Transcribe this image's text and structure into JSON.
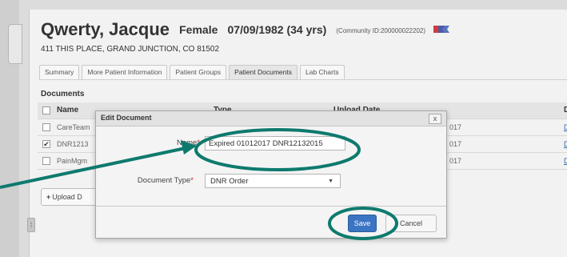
{
  "patient": {
    "name": "Qwerty, Jacque",
    "gender": "Female",
    "dob": "07/09/1982 (34 yrs)",
    "community_id": "(Community ID:200000022202)",
    "address": "411 THIS PLACE, GRAND JUNCTION, CO 81502"
  },
  "tabs": [
    {
      "label": "Summary"
    },
    {
      "label": "More Patient Information"
    },
    {
      "label": "Patient Groups"
    },
    {
      "label": "Patient Documents"
    },
    {
      "label": "Lab Charts"
    }
  ],
  "documents": {
    "section_title": "Documents",
    "columns": {
      "name": "Name",
      "type": "Type",
      "upload_date": "Upload Date",
      "doc": "Do"
    },
    "rows": [
      {
        "name": "CareTeam",
        "date": "017",
        "doc": "DC",
        "checked": false
      },
      {
        "name": "DNR1213",
        "date": "017",
        "doc": "DC",
        "checked": true
      },
      {
        "name": "PainMgm",
        "date": "017",
        "doc": "DC",
        "checked": false
      }
    ],
    "upload_label": "Upload D"
  },
  "dialog": {
    "title": "Edit Document",
    "close_label": "x",
    "name_label": "Name",
    "name_value": "Expired 01012017 DNR12132015",
    "type_label": "Document Type",
    "type_value": "DNR Order",
    "save_label": "Save",
    "cancel_label": "Cancel",
    "required_mark": "*"
  },
  "colors": {
    "annotation": "#0e7a6e",
    "save_button": "#3a74c2",
    "required": "#cc2222",
    "flag_red": "#d23a3a",
    "flag_blue": "#3a5fb8"
  },
  "icons": {
    "flag": "flag-icon",
    "plus": "plus-icon",
    "caret": "caret-down-icon",
    "close": "close-icon",
    "check": "check-icon"
  }
}
